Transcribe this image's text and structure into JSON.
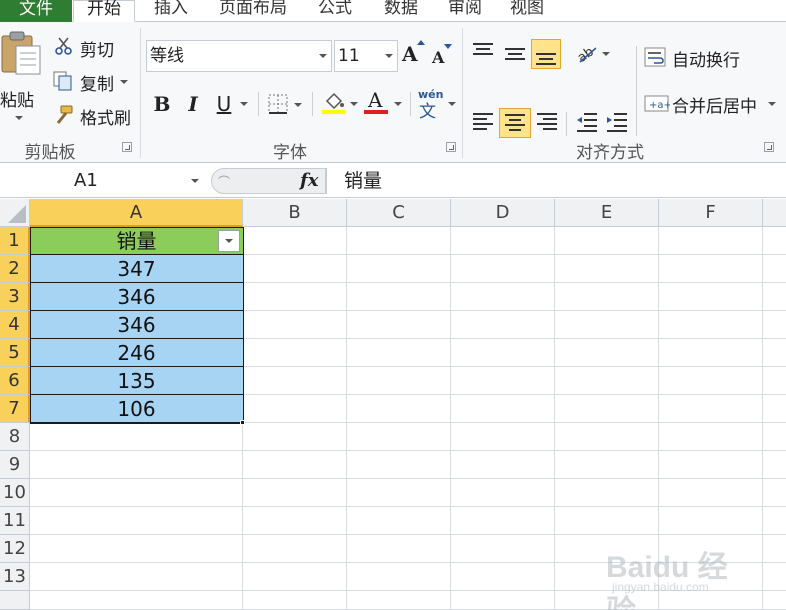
{
  "tabs": {
    "file": "文件",
    "items": [
      "开始",
      "插入",
      "页面布局",
      "公式",
      "数据",
      "审阅",
      "视图"
    ]
  },
  "clipboard": {
    "paste": "粘贴",
    "cut": "剪切",
    "copy": "复制",
    "format_painter": "格式刷",
    "label": "剪贴板"
  },
  "font": {
    "name": "等线",
    "size": "11",
    "bold": "B",
    "italic": "I",
    "underline": "U",
    "font_color_glyph": "A",
    "phonetic_top": "wén",
    "phonetic_bottom": "文",
    "grow_glyph": "A",
    "shrink_glyph": "A",
    "label": "字体",
    "font_color": "#e02020",
    "fill_color": "#ffff00"
  },
  "alignment": {
    "wrap_text": "自动换行",
    "merge_center": "合并后居中",
    "label": "对齐方式"
  },
  "formula_bar": {
    "name_box": "A1",
    "fx": "fx",
    "value": "销量"
  },
  "grid": {
    "columns": [
      "A",
      "B",
      "C",
      "D",
      "E",
      "F"
    ],
    "rows": [
      "1",
      "2",
      "3",
      "4",
      "5",
      "6",
      "7",
      "8",
      "9",
      "10",
      "11",
      "12",
      "13"
    ],
    "header_cell": "销量",
    "values": [
      "347",
      "346",
      "346",
      "246",
      "135",
      "106"
    ]
  },
  "colors": {
    "header_fill": "#8ccc5b",
    "data_fill": "#a8d4f4",
    "selected_heading": "#f9d05a",
    "file_tab": "#2e7d32"
  },
  "watermark": {
    "main": "Baidu 经验",
    "sub": "jingyan.baidu.com"
  }
}
